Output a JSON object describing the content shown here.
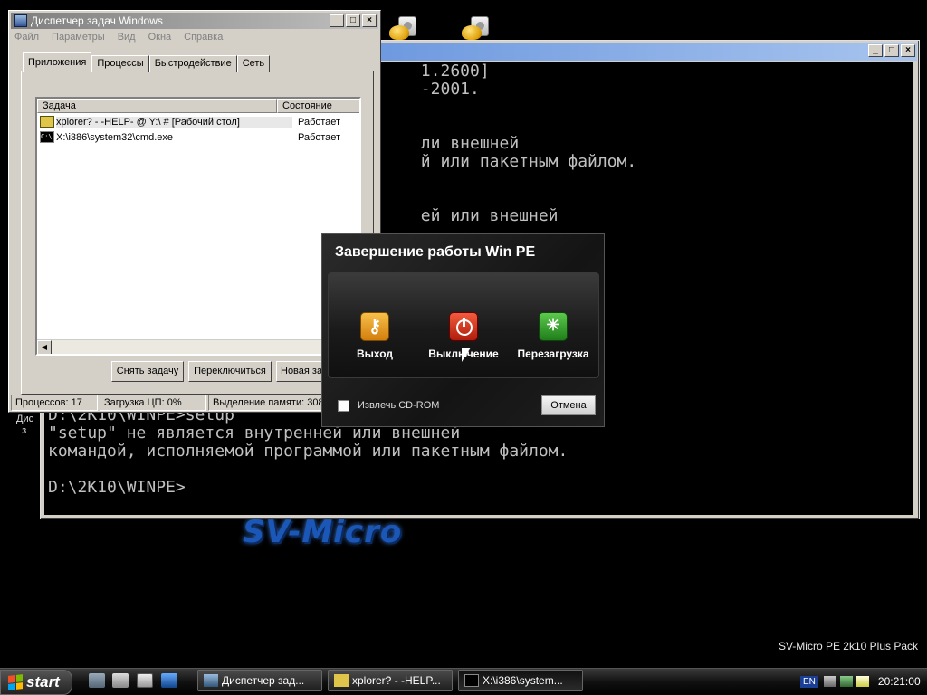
{
  "taskmgr": {
    "title": "Диспетчер задач Windows",
    "menu": [
      "Файл",
      "Параметры",
      "Вид",
      "Окна",
      "Справка"
    ],
    "tabs": [
      "Приложения",
      "Процессы",
      "Быстродействие",
      "Сеть"
    ],
    "columns": {
      "task": "Задача",
      "state": "Состояние"
    },
    "rows": [
      {
        "task": "xplorer? - -HELP- @ Y:\\ # [Рабочий стол]",
        "state": "Работает",
        "icon": "explorer-icon"
      },
      {
        "task": "X:\\i386\\system32\\cmd.exe",
        "state": "Работает",
        "icon": "cmd-icon"
      }
    ],
    "buttons": {
      "end_task": "Снять задачу",
      "switch": "Переключиться",
      "new_task": "Новая задача..."
    },
    "status": {
      "processes": "Процессов: 17",
      "cpu": "Загрузка ЦП: 0%",
      "memory": "Выделение памяти: 308"
    }
  },
  "cmd": {
    "lines": [
      "                                      1.2600]",
      "                                      -2001.",
      "",
      "",
      "                                      ли внешней",
      "                                      й или пакетным файлом.",
      "",
      "",
      "                                      ей или внешней",
      "                                                    .",
      "",
      "",
      "                                                    .",
      "",
      "",
      "",
      "                                                    .",
      "",
      "",
      "D:\\2K10\\WINPE>setup",
      "\"setup\" не является внутренней или внешней",
      "командой, исполняемой программой или пакетным файлом.",
      "",
      "D:\\2K10\\WINPE>"
    ],
    "window_buttons": {
      "minimize": "_",
      "maximize": "□",
      "close": "×"
    }
  },
  "shutdown": {
    "title": "Завершение работы Win PE",
    "options": {
      "logoff": "Выход",
      "shutdown": "Выключение",
      "restart": "Перезагрузка"
    },
    "eject_label": "Извлечь CD-ROM",
    "cancel_label": "Отмена"
  },
  "desktop": {
    "logo_text": "SV-Micro",
    "pack_label": "SV-Micro PE 2k10 Plus Pack",
    "bg_text": "Дис\n  з"
  },
  "taskbar": {
    "start_label": "start",
    "quick_launch": [
      "desktop-icon",
      "sfx-icon",
      "calculator-icon",
      "window-icon"
    ],
    "tasks": [
      {
        "label": "Диспетчер зад...",
        "icon": "taskmgr-icon"
      },
      {
        "label": "xplorer? - -HELP...",
        "icon": "explorer-icon"
      },
      {
        "label": "X:\\i386\\system...",
        "icon": "cmd-icon"
      }
    ],
    "tray": {
      "lang": "EN",
      "time": "20:21:00"
    }
  },
  "colors": {
    "cmd_text": "#c0c0c0",
    "titlebar_active": "#4b7fd6",
    "logo": "#1b57b6"
  }
}
